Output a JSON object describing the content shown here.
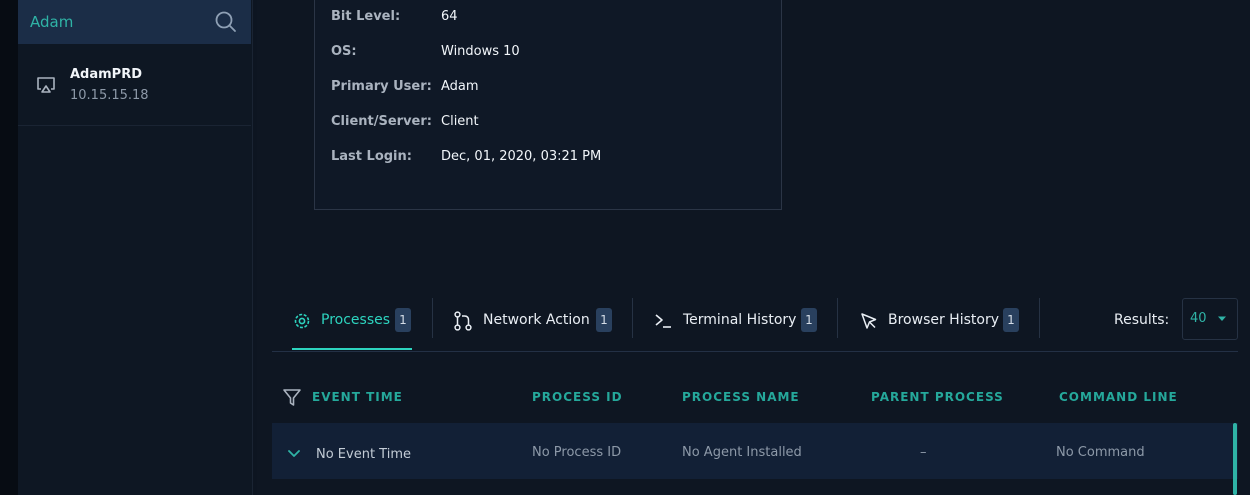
{
  "search": {
    "value": "Adam"
  },
  "device": {
    "name": "AdamPRD",
    "ip": "10.15.15.18"
  },
  "info": [
    {
      "label": "Bit Level:",
      "value": "64"
    },
    {
      "label": "OS:",
      "value": "Windows 10"
    },
    {
      "label": "Primary User:",
      "value": "Adam"
    },
    {
      "label": "Client/Server:",
      "value": "Client"
    },
    {
      "label": "Last Login:",
      "value": "Dec, 01, 2020, 03:21 PM"
    }
  ],
  "tabs": [
    {
      "label": "Processes",
      "count": "1",
      "icon": "gear-icon",
      "active": true
    },
    {
      "label": "Network Action",
      "count": "1",
      "icon": "git-branch-icon"
    },
    {
      "label": "Terminal History",
      "count": "1",
      "icon": "terminal-icon"
    },
    {
      "label": "Browser History",
      "count": "1",
      "icon": "cursor-arrow-icon"
    }
  ],
  "results": {
    "label": "Results:",
    "value": "40"
  },
  "table": {
    "headers": [
      "EVENT TIME",
      "PROCESS ID",
      "PROCESS NAME",
      "PARENT PROCESS",
      "COMMAND LINE"
    ],
    "rows": [
      {
        "event_time": "No Event Time",
        "process_id": "No Process ID",
        "process_name": "No Agent Installed",
        "parent_process": "–",
        "command_line": "No Command"
      }
    ]
  },
  "colors": {
    "accent": "#2dd4bf",
    "background": "#0e1622",
    "sidebar": "#0e1723",
    "search_bg": "#1b2d47",
    "row_bg": "#122036"
  }
}
